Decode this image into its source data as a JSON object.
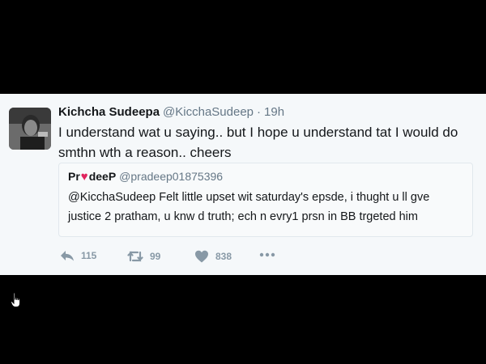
{
  "tweet": {
    "display_name": "Kichcha Sudeepa",
    "handle": "@KicchaSudeep",
    "separator": "·",
    "time": "19h",
    "text": "I understand wat u saying.. but I hope u understand tat I would do smthn wth a reason.. cheers"
  },
  "quoted_tweet": {
    "name_prefix": "Pr",
    "name_suffix": "deeP",
    "heart_glyph": "♥",
    "handle": "@pradeep01875396",
    "text": "@KicchaSudeep Felt little upset wit saturday's epsde, i thught u ll gve justice 2 pratham, u knw d truth; ech n evry1 prsn in BB trgeted him"
  },
  "actions": {
    "reply_count": "115",
    "retweet_count": "99",
    "like_count": "838",
    "icons": [
      "reply-icon",
      "retweet-icon",
      "like-icon",
      "more-icon"
    ]
  },
  "colors": {
    "background": "#000000",
    "card": "#f5f8fa",
    "text": "#14171a",
    "muted": "#657786",
    "icon": "#8899a6",
    "heart": "#e0245e"
  }
}
